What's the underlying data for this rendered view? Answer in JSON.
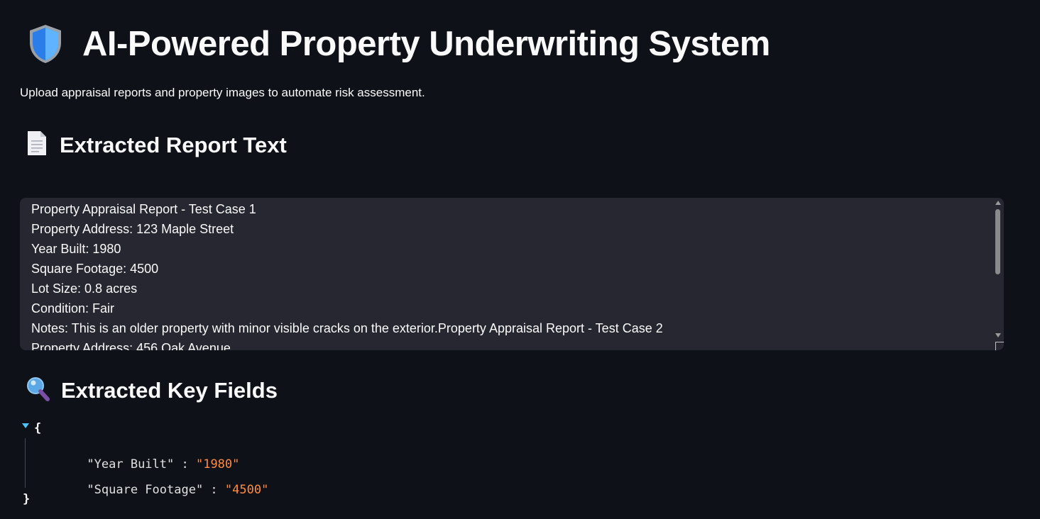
{
  "header": {
    "title": "AI-Powered Property Underwriting System",
    "subtitle": "Upload appraisal reports and property images to automate risk assessment.",
    "icon": "shield-icon"
  },
  "report_section": {
    "heading": "Extracted Report Text",
    "icon": "document-icon",
    "text": "Property Appraisal Report - Test Case 1\nProperty Address: 123 Maple Street\nYear Built: 1980\nSquare Footage: 4500\nLot Size: 0.8 acres\nCondition: Fair\nNotes: This is an older property with minor visible cracks on the exterior.Property Appraisal Report - Test Case 2\nProperty Address: 456 Oak Avenue"
  },
  "fields_section": {
    "heading": "Extracted Key Fields",
    "icon": "magnifier-icon",
    "open_brace": "{",
    "close_brace": "}",
    "fields": [
      {
        "key": "\"Year Built\"",
        "colon": " : ",
        "value": "\"1980\""
      },
      {
        "key": "\"Square Footage\"",
        "colon": " : ",
        "value": "\"4500\""
      }
    ]
  },
  "colors": {
    "background": "#0e1117",
    "textarea": "#262730",
    "json_value": "#ff8c42",
    "toggle": "#4fc3f7"
  }
}
